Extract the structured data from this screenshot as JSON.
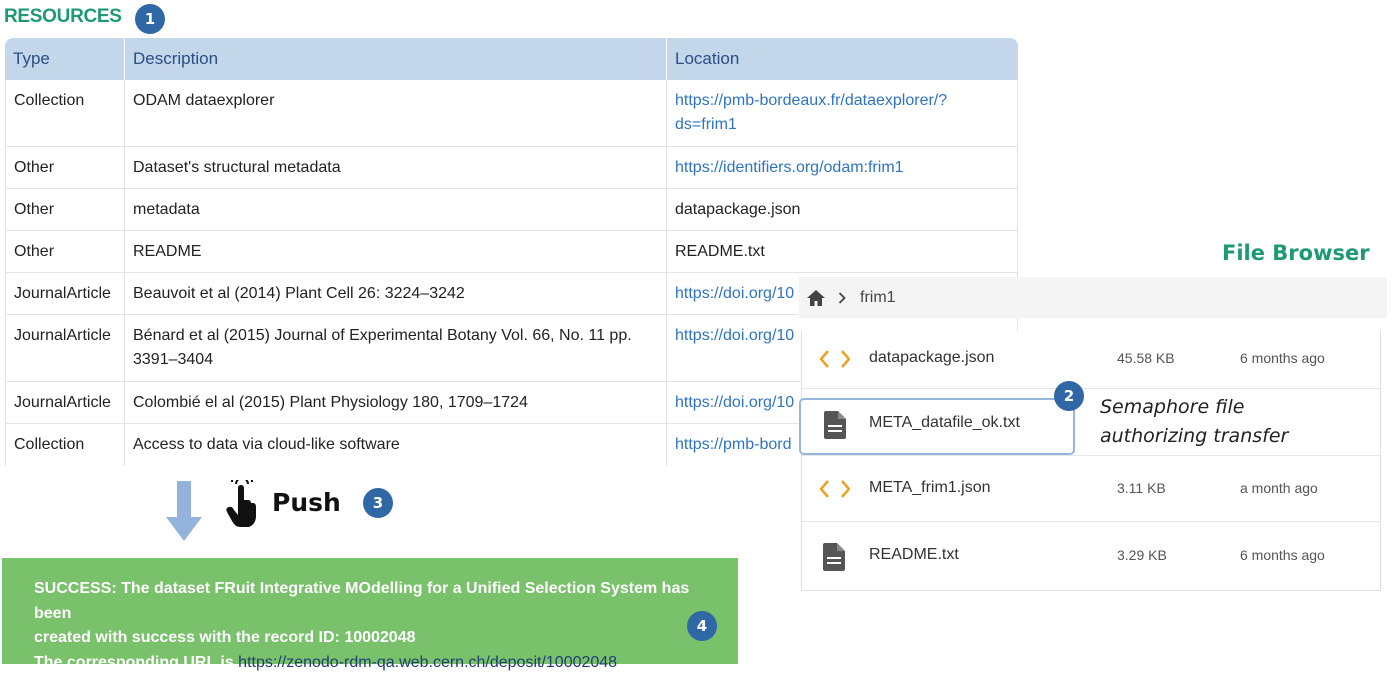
{
  "resources": {
    "title": "RESOURCES",
    "headers": [
      "Type",
      "Description",
      "Location"
    ],
    "rows": [
      {
        "type": "Collection",
        "description": "ODAM dataexplorer",
        "location": "https://pmb-bordeaux.fr/dataexplorer/?ds=frim1",
        "location_line1": "https://pmb-bordeaux.fr/dataexplorer/?",
        "location_line2": "ds=frim1",
        "is_link": true
      },
      {
        "type": "Other",
        "description": "Dataset's structural metadata",
        "location": "https://identifiers.org/odam:frim1",
        "is_link": true
      },
      {
        "type": "Other",
        "description": "metadata",
        "location": "datapackage.json",
        "is_link": false
      },
      {
        "type": "Other",
        "description": "README",
        "location": "README.txt",
        "is_link": false
      },
      {
        "type": "JournalArticle",
        "description": "Beauvoit et al (2014) Plant Cell 26: 3224–3242",
        "location": "https://doi.org/10",
        "is_link": true
      },
      {
        "type": "JournalArticle",
        "description_line1": "Bénard et al (2015) Journal of Experimental Botany Vol. 66, No. 11 pp.",
        "description_line2": "3391–3404",
        "location": "https://doi.org/10",
        "is_link": true
      },
      {
        "type": "JournalArticle",
        "description": "Colombié el al (2015) Plant Physiology 180, 1709–1724",
        "location": "https://doi.org/10",
        "is_link": true
      },
      {
        "type": "Collection",
        "description": "Access to data via cloud-like software",
        "location": "https://pmb-bord",
        "is_link": true
      }
    ]
  },
  "badges": {
    "b1": "1",
    "b2": "2",
    "b3": "3",
    "b4": "4"
  },
  "push": {
    "label": "Push",
    "hand_icon": "pointing-hand-icon",
    "arrow_icon": "down-arrow-icon"
  },
  "success": {
    "line1": "SUCCESS: The dataset FRuit Integrative MOdelling for a Unified Selection System has been",
    "line2": "created with success with the record ID: 10002048",
    "line3_prefix": "The corresponding URL is ",
    "url": "https://zenodo-rdm-qa.web.cern.ch/deposit/10002048",
    "background": "#79c16b"
  },
  "file_browser": {
    "title": "File Browser",
    "breadcrumb": {
      "home_icon": "home-icon",
      "separator_icon": "chevron-right-icon",
      "folder": "frim1"
    },
    "files": [
      {
        "name": "datapackage.json",
        "size": "45.58 KB",
        "modified": "6 months ago",
        "icon": "code-icon"
      },
      {
        "name": "META_datafile_ok.txt",
        "size": "",
        "modified": "",
        "icon": "file-icon"
      },
      {
        "name": "META_frim1.json",
        "size": "3.11 KB",
        "modified": "a month ago",
        "icon": "code-icon"
      },
      {
        "name": "README.txt",
        "size": "3.29 KB",
        "modified": "6 months ago",
        "icon": "file-icon"
      }
    ],
    "semaphore_note_line1": "Semaphore file",
    "semaphore_note_line2": "authorizing transfer"
  },
  "colors": {
    "accent_green": "#1e9a72",
    "badge_blue": "#2f68a4",
    "header_blue": "#c3d6ea",
    "link_blue": "#2e74c3",
    "code_orange": "#f0a020"
  }
}
